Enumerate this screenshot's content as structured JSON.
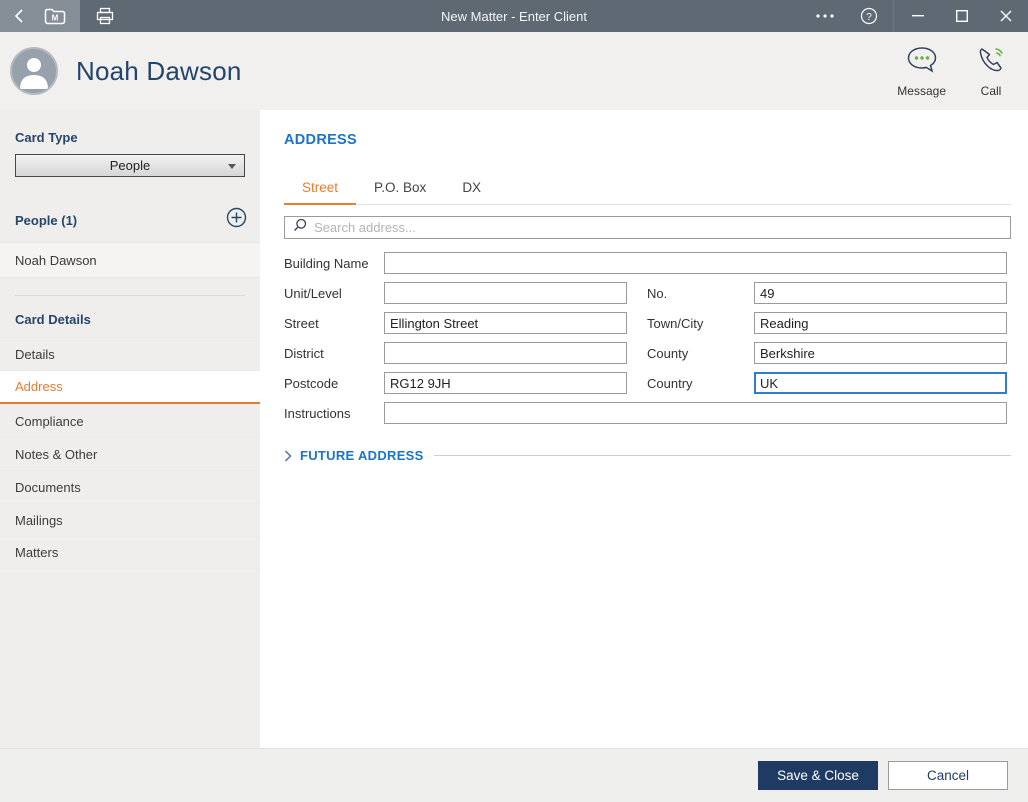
{
  "titlebar": {
    "title": "New Matter - Enter Client"
  },
  "header": {
    "name": "Noah Dawson",
    "message_label": "Message",
    "call_label": "Call"
  },
  "sidebar": {
    "card_type_label": "Card Type",
    "card_type_value": "People",
    "people_header": "People (1)",
    "people_items": [
      {
        "label": "Noah Dawson"
      }
    ],
    "card_details_header": "Card Details",
    "items": [
      {
        "label": "Details"
      },
      {
        "label": "Address",
        "selected": true
      },
      {
        "label": "Compliance"
      },
      {
        "label": "Notes & Other"
      },
      {
        "label": "Documents"
      },
      {
        "label": "Mailings"
      },
      {
        "label": "Matters"
      }
    ]
  },
  "main": {
    "section_title": "ADDRESS",
    "tabs": [
      {
        "label": "Street",
        "active": true
      },
      {
        "label": "P.O. Box"
      },
      {
        "label": "DX"
      }
    ],
    "search": {
      "placeholder": "Search address..."
    },
    "fields": {
      "building_name": {
        "label": "Building Name",
        "value": ""
      },
      "unit_level": {
        "label": "Unit/Level",
        "value": ""
      },
      "no": {
        "label": "No.",
        "value": "49"
      },
      "street": {
        "label": "Street",
        "value": "Ellington Street"
      },
      "town_city": {
        "label": "Town/City",
        "value": "Reading"
      },
      "district": {
        "label": "District",
        "value": ""
      },
      "county": {
        "label": "County",
        "value": "Berkshire"
      },
      "postcode": {
        "label": "Postcode",
        "value": "RG12 9JH"
      },
      "country": {
        "label": "Country",
        "value": "UK",
        "focused": true
      },
      "instructions": {
        "label": "Instructions",
        "value": ""
      }
    },
    "future_address_label": "FUTURE ADDRESS"
  },
  "footer": {
    "save_label": "Save & Close",
    "cancel_label": "Cancel"
  },
  "icons": {
    "folder_letter": "M",
    "help_glyph": "?"
  },
  "colors": {
    "titlebar": "#5e6973",
    "titlebar_left": "#858d96",
    "accent_orange": "#e87b2d",
    "heading_blue": "#1b74c8",
    "navy_text": "#24466b",
    "button_navy": "#1f3b63",
    "panel_gray": "#efeeed",
    "icon_green": "#5fb246"
  }
}
